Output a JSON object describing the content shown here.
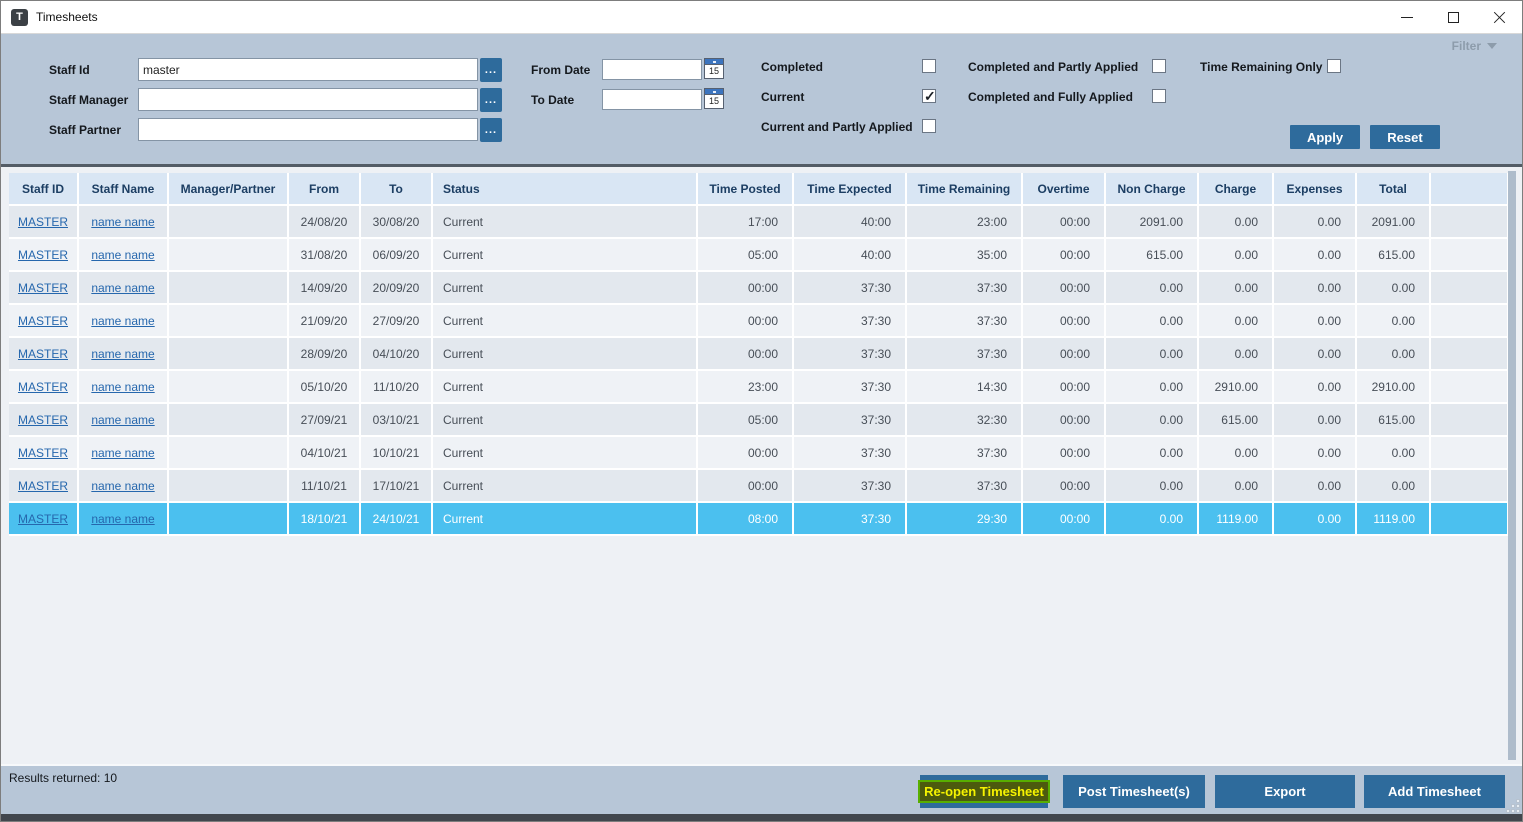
{
  "window": {
    "icon_letter": "T",
    "title": "Timesheets"
  },
  "filter": {
    "toggle_label": "Filter",
    "fields": [
      {
        "label": "Staff Id",
        "value": "master"
      },
      {
        "label": "Staff Manager",
        "value": ""
      },
      {
        "label": "Staff Partner",
        "value": ""
      }
    ],
    "browse_label": "...",
    "date_fields": [
      {
        "label": "From Date",
        "value": ""
      },
      {
        "label": "To Date",
        "value": ""
      }
    ],
    "calendar_day": "15",
    "checkboxes": [
      {
        "label": "Completed",
        "checked": false
      },
      {
        "label": "Current",
        "checked": true
      },
      {
        "label": "Current and Partly Applied",
        "checked": false
      },
      {
        "label": "Completed and Partly Applied",
        "checked": false
      },
      {
        "label": "Completed and Fully Applied",
        "checked": false
      },
      {
        "label": "Time Remaining Only",
        "checked": false
      }
    ],
    "apply_label": "Apply",
    "reset_label": "Reset"
  },
  "table": {
    "columns": [
      "Staff ID",
      "Staff Name",
      "Manager/Partner",
      "From",
      "To",
      "Status",
      "Time Posted",
      "Time Expected",
      "Time Remaining",
      "Overtime",
      "Non Charge",
      "Charge",
      "Expenses",
      "Total",
      ""
    ],
    "selected_row_index": 9,
    "rows": [
      {
        "staff_id": "MASTER",
        "staff_name": "name name",
        "manager_partner": "",
        "from": "24/08/20",
        "to": "30/08/20",
        "status": "Current",
        "time_posted": "17:00",
        "time_expected": "40:00",
        "time_remaining": "23:00",
        "overtime": "00:00",
        "non_charge": "2091.00",
        "charge": "0.00",
        "expenses": "0.00",
        "total": "2091.00"
      },
      {
        "staff_id": "MASTER",
        "staff_name": "name name",
        "manager_partner": "",
        "from": "31/08/20",
        "to": "06/09/20",
        "status": "Current",
        "time_posted": "05:00",
        "time_expected": "40:00",
        "time_remaining": "35:00",
        "overtime": "00:00",
        "non_charge": "615.00",
        "charge": "0.00",
        "expenses": "0.00",
        "total": "615.00"
      },
      {
        "staff_id": "MASTER",
        "staff_name": "name name",
        "manager_partner": "",
        "from": "14/09/20",
        "to": "20/09/20",
        "status": "Current",
        "time_posted": "00:00",
        "time_expected": "37:30",
        "time_remaining": "37:30",
        "overtime": "00:00",
        "non_charge": "0.00",
        "charge": "0.00",
        "expenses": "0.00",
        "total": "0.00"
      },
      {
        "staff_id": "MASTER",
        "staff_name": "name name",
        "manager_partner": "",
        "from": "21/09/20",
        "to": "27/09/20",
        "status": "Current",
        "time_posted": "00:00",
        "time_expected": "37:30",
        "time_remaining": "37:30",
        "overtime": "00:00",
        "non_charge": "0.00",
        "charge": "0.00",
        "expenses": "0.00",
        "total": "0.00"
      },
      {
        "staff_id": "MASTER",
        "staff_name": "name name",
        "manager_partner": "",
        "from": "28/09/20",
        "to": "04/10/20",
        "status": "Current",
        "time_posted": "00:00",
        "time_expected": "37:30",
        "time_remaining": "37:30",
        "overtime": "00:00",
        "non_charge": "0.00",
        "charge": "0.00",
        "expenses": "0.00",
        "total": "0.00"
      },
      {
        "staff_id": "MASTER",
        "staff_name": "name name",
        "manager_partner": "",
        "from": "05/10/20",
        "to": "11/10/20",
        "status": "Current",
        "time_posted": "23:00",
        "time_expected": "37:30",
        "time_remaining": "14:30",
        "overtime": "00:00",
        "non_charge": "0.00",
        "charge": "2910.00",
        "expenses": "0.00",
        "total": "2910.00"
      },
      {
        "staff_id": "MASTER",
        "staff_name": "name name",
        "manager_partner": "",
        "from": "27/09/21",
        "to": "03/10/21",
        "status": "Current",
        "time_posted": "05:00",
        "time_expected": "37:30",
        "time_remaining": "32:30",
        "overtime": "00:00",
        "non_charge": "0.00",
        "charge": "615.00",
        "expenses": "0.00",
        "total": "615.00"
      },
      {
        "staff_id": "MASTER",
        "staff_name": "name name",
        "manager_partner": "",
        "from": "04/10/21",
        "to": "10/10/21",
        "status": "Current",
        "time_posted": "00:00",
        "time_expected": "37:30",
        "time_remaining": "37:30",
        "overtime": "00:00",
        "non_charge": "0.00",
        "charge": "0.00",
        "expenses": "0.00",
        "total": "0.00"
      },
      {
        "staff_id": "MASTER",
        "staff_name": "name name",
        "manager_partner": "",
        "from": "11/10/21",
        "to": "17/10/21",
        "status": "Current",
        "time_posted": "00:00",
        "time_expected": "37:30",
        "time_remaining": "37:30",
        "overtime": "00:00",
        "non_charge": "0.00",
        "charge": "0.00",
        "expenses": "0.00",
        "total": "0.00"
      },
      {
        "staff_id": "MASTER",
        "staff_name": "name name",
        "manager_partner": "",
        "from": "18/10/21",
        "to": "24/10/21",
        "status": "Current",
        "time_posted": "08:00",
        "time_expected": "37:30",
        "time_remaining": "29:30",
        "overtime": "00:00",
        "non_charge": "0.00",
        "charge": "1119.00",
        "expenses": "0.00",
        "total": "1119.00"
      }
    ]
  },
  "footer": {
    "results_text": "Results returned: 10",
    "buttons": {
      "reopen": "Re-open Timesheet",
      "post": "Post Timesheet(s)",
      "export": "Export",
      "add": "Add Timesheet"
    }
  },
  "colors": {
    "accent_button": "#2e6b9c",
    "selected_row": "#4bc0ef",
    "link": "#2667ad",
    "highlight_text": "#f6f300",
    "highlight_bg": "#4c5a0e",
    "highlight_border": "#58ae00"
  }
}
